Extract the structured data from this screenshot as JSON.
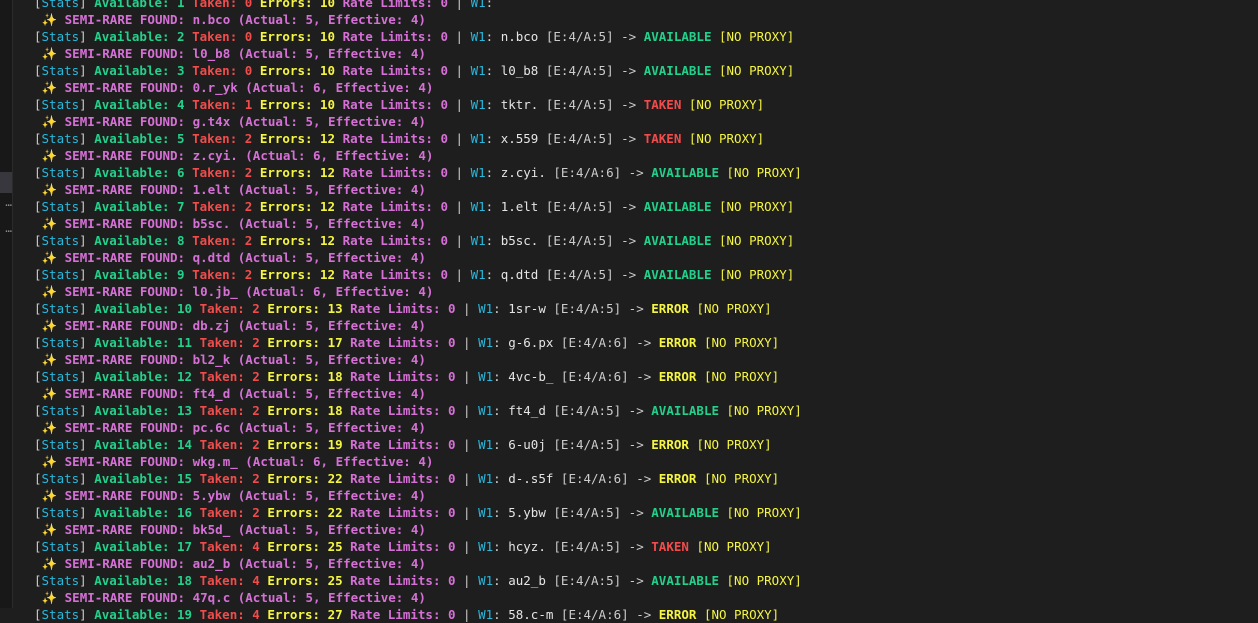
{
  "terminal": {
    "labels": {
      "semi_rare": "SEMI-RARE FOUND:",
      "stats": "Stats",
      "available": "Available:",
      "taken": "Taken:",
      "errors": "Errors:",
      "rate_limits": "Rate Limits:",
      "worker": "W1",
      "no_proxy": "[NO PROXY]",
      "arrow": "->",
      "sparkle": "✨"
    },
    "lines": [
      {
        "type": "stats",
        "partial": true,
        "available": "1",
        "taken": "0",
        "errors": "10",
        "rate": "0",
        "name": "",
        "ea": "",
        "status": ""
      },
      {
        "type": "rare",
        "name": "n.bco",
        "actual": "5",
        "effective": "4"
      },
      {
        "type": "stats",
        "available": "2",
        "taken": "0",
        "errors": "10",
        "rate": "0",
        "name": "n.bco",
        "ea": "[E:4/A:5]",
        "status": "AVAILABLE"
      },
      {
        "type": "rare",
        "name": "l0_b8",
        "actual": "5",
        "effective": "4"
      },
      {
        "type": "stats",
        "available": "3",
        "taken": "0",
        "errors": "10",
        "rate": "0",
        "name": "l0_b8",
        "ea": "[E:4/A:5]",
        "status": "AVAILABLE"
      },
      {
        "type": "rare",
        "name": "0.r_yk",
        "actual": "6",
        "effective": "4"
      },
      {
        "type": "stats",
        "available": "4",
        "taken": "1",
        "errors": "10",
        "rate": "0",
        "name": "tktr.",
        "ea": "[E:4/A:5]",
        "status": "TAKEN"
      },
      {
        "type": "rare",
        "name": "g.t4x",
        "actual": "5",
        "effective": "4"
      },
      {
        "type": "stats",
        "available": "5",
        "taken": "2",
        "errors": "12",
        "rate": "0",
        "name": "x.559",
        "ea": "[E:4/A:5]",
        "status": "TAKEN"
      },
      {
        "type": "rare",
        "name": "z.cyi.",
        "actual": "6",
        "effective": "4"
      },
      {
        "type": "stats",
        "available": "6",
        "taken": "2",
        "errors": "12",
        "rate": "0",
        "name": "z.cyi.",
        "ea": "[E:4/A:6]",
        "status": "AVAILABLE"
      },
      {
        "type": "rare",
        "name": "1.elt",
        "actual": "5",
        "effective": "4"
      },
      {
        "type": "stats",
        "available": "7",
        "taken": "2",
        "errors": "12",
        "rate": "0",
        "name": "1.elt",
        "ea": "[E:4/A:5]",
        "status": "AVAILABLE"
      },
      {
        "type": "rare",
        "name": "b5sc.",
        "actual": "5",
        "effective": "4"
      },
      {
        "type": "stats",
        "available": "8",
        "taken": "2",
        "errors": "12",
        "rate": "0",
        "name": "b5sc.",
        "ea": "[E:4/A:5]",
        "status": "AVAILABLE"
      },
      {
        "type": "rare",
        "name": "q.dtd",
        "actual": "5",
        "effective": "4"
      },
      {
        "type": "stats",
        "available": "9",
        "taken": "2",
        "errors": "12",
        "rate": "0",
        "name": "q.dtd",
        "ea": "[E:4/A:5]",
        "status": "AVAILABLE"
      },
      {
        "type": "rare",
        "name": "l0.jb_",
        "actual": "6",
        "effective": "4"
      },
      {
        "type": "stats",
        "available": "10",
        "taken": "2",
        "errors": "13",
        "rate": "0",
        "name": "1sr-w",
        "ea": "[E:4/A:5]",
        "status": "ERROR"
      },
      {
        "type": "rare",
        "name": "db.zj",
        "actual": "5",
        "effective": "4"
      },
      {
        "type": "stats",
        "available": "11",
        "taken": "2",
        "errors": "17",
        "rate": "0",
        "name": "g-6.px",
        "ea": "[E:4/A:6]",
        "status": "ERROR"
      },
      {
        "type": "rare",
        "name": "bl2_k",
        "actual": "5",
        "effective": "4"
      },
      {
        "type": "stats",
        "available": "12",
        "taken": "2",
        "errors": "18",
        "rate": "0",
        "name": "4vc-b_",
        "ea": "[E:4/A:6]",
        "status": "ERROR"
      },
      {
        "type": "rare",
        "name": "ft4_d",
        "actual": "5",
        "effective": "4"
      },
      {
        "type": "stats",
        "available": "13",
        "taken": "2",
        "errors": "18",
        "rate": "0",
        "name": "ft4_d",
        "ea": "[E:4/A:5]",
        "status": "AVAILABLE"
      },
      {
        "type": "rare",
        "name": "pc.6c",
        "actual": "5",
        "effective": "4"
      },
      {
        "type": "stats",
        "available": "14",
        "taken": "2",
        "errors": "19",
        "rate": "0",
        "name": "6-u0j",
        "ea": "[E:4/A:5]",
        "status": "ERROR"
      },
      {
        "type": "rare",
        "name": "wkg.m_",
        "actual": "6",
        "effective": "4"
      },
      {
        "type": "stats",
        "available": "15",
        "taken": "2",
        "errors": "22",
        "rate": "0",
        "name": "d-.s5f",
        "ea": "[E:4/A:6]",
        "status": "ERROR"
      },
      {
        "type": "rare",
        "name": "5.ybw",
        "actual": "5",
        "effective": "4"
      },
      {
        "type": "stats",
        "available": "16",
        "taken": "2",
        "errors": "22",
        "rate": "0",
        "name": "5.ybw",
        "ea": "[E:4/A:5]",
        "status": "AVAILABLE"
      },
      {
        "type": "rare",
        "name": "bk5d_",
        "actual": "5",
        "effective": "4"
      },
      {
        "type": "stats",
        "available": "17",
        "taken": "4",
        "errors": "25",
        "rate": "0",
        "name": "hcyz.",
        "ea": "[E:4/A:5]",
        "status": "TAKEN"
      },
      {
        "type": "rare",
        "name": "au2_b",
        "actual": "5",
        "effective": "4"
      },
      {
        "type": "stats",
        "available": "18",
        "taken": "4",
        "errors": "25",
        "rate": "0",
        "name": "au2_b",
        "ea": "[E:4/A:5]",
        "status": "AVAILABLE"
      },
      {
        "type": "rare",
        "name": "47q.c",
        "actual": "5",
        "effective": "4"
      },
      {
        "type": "stats",
        "available": "19",
        "taken": "4",
        "errors": "27",
        "rate": "0",
        "name": "58.c-m",
        "ea": "[E:4/A:6]",
        "status": "ERROR"
      }
    ]
  }
}
